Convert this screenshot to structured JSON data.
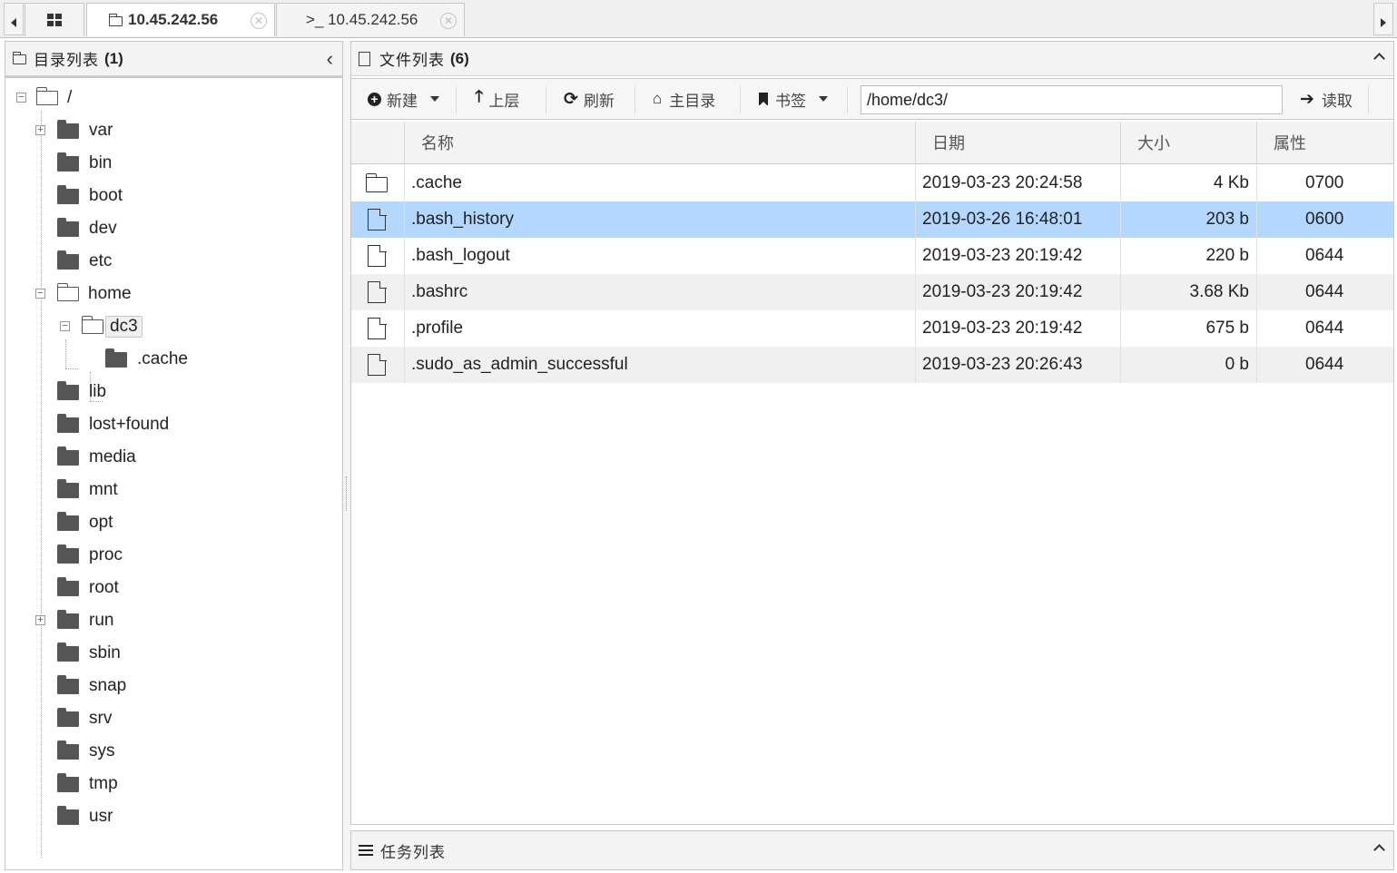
{
  "tabs": [
    {
      "label": "10.45.242.56",
      "icon": "folder-icon",
      "active": true
    },
    {
      "label": ">_ 10.45.242.56",
      "icon": "terminal-icon",
      "active": false
    }
  ],
  "directory_panel": {
    "title": "目录列表",
    "count": "(1)",
    "tree": [
      {
        "label": "/"
      },
      {
        "label": "var"
      },
      {
        "label": "bin"
      },
      {
        "label": "boot"
      },
      {
        "label": "dev"
      },
      {
        "label": "etc"
      },
      {
        "label": "home"
      },
      {
        "label": "dc3"
      },
      {
        "label": ".cache"
      },
      {
        "label": "lib"
      },
      {
        "label": "lost+found"
      },
      {
        "label": "media"
      },
      {
        "label": "mnt"
      },
      {
        "label": "opt"
      },
      {
        "label": "proc"
      },
      {
        "label": "root"
      },
      {
        "label": "run"
      },
      {
        "label": "sbin"
      },
      {
        "label": "snap"
      },
      {
        "label": "srv"
      },
      {
        "label": "sys"
      },
      {
        "label": "tmp"
      },
      {
        "label": "usr"
      }
    ]
  },
  "file_panel": {
    "title": "文件列表",
    "count": "(6)",
    "toolbar": {
      "new": "新建",
      "up": "上层",
      "refresh": "刷新",
      "home": "主目录",
      "bookmark": "书签",
      "path": "/home/dc3/",
      "read": "读取"
    },
    "columns": [
      "名称",
      "日期",
      "大小",
      "属性"
    ],
    "rows": [
      {
        "name": ".cache",
        "date": "2019-03-23 20:24:58",
        "size": "4 Kb",
        "attr": "0700",
        "type": "folder"
      },
      {
        "name": ".bash_history",
        "date": "2019-03-26 16:48:01",
        "size": "203 b",
        "attr": "0600",
        "type": "file"
      },
      {
        "name": ".bash_logout",
        "date": "2019-03-23 20:19:42",
        "size": "220 b",
        "attr": "0644",
        "type": "file"
      },
      {
        "name": ".bashrc",
        "date": "2019-03-23 20:19:42",
        "size": "3.68 Kb",
        "attr": "0644",
        "type": "file"
      },
      {
        "name": ".profile",
        "date": "2019-03-23 20:19:42",
        "size": "675 b",
        "attr": "0644",
        "type": "file"
      },
      {
        "name": ".sudo_as_admin_successful",
        "date": "2019-03-23 20:26:43",
        "size": "0 b",
        "attr": "0644",
        "type": "file"
      }
    ]
  },
  "task_panel": {
    "title": "任务列表"
  },
  "colors": {
    "selection": "#b3d7ff",
    "alt_row": "#f0f0f0",
    "header": "#f3f3f3"
  }
}
